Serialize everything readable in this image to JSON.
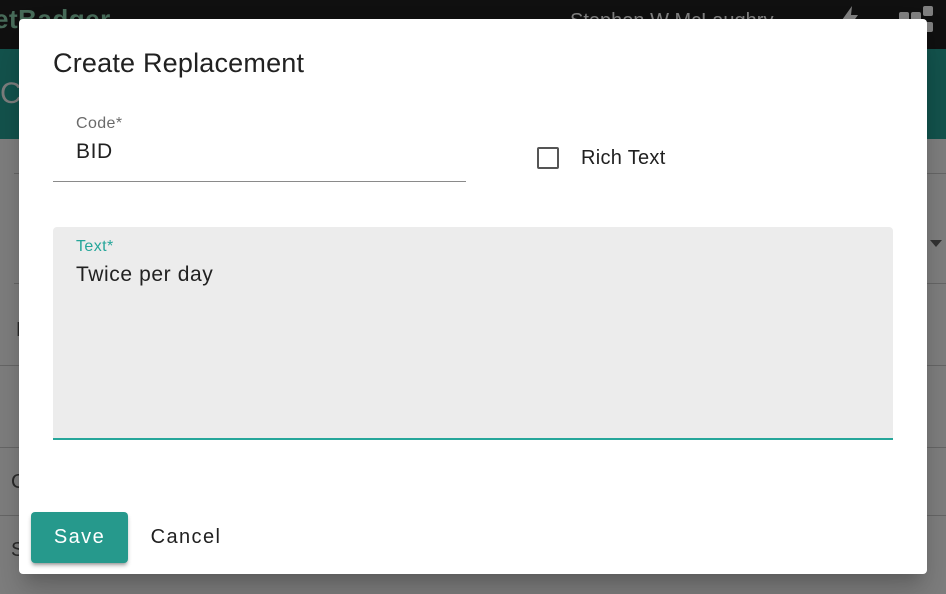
{
  "background_app": {
    "brand": "etBadger",
    "user_name": "Stephen W McLaughry",
    "green_initial": "C",
    "row_letters": [
      "E",
      "C",
      "S"
    ]
  },
  "dialog": {
    "title": "Create Replacement",
    "code": {
      "label": "Code*",
      "value": "BID"
    },
    "rich_text": {
      "label": "Rich Text",
      "checked": false
    },
    "text": {
      "label": "Text*",
      "value": "Twice per day"
    },
    "actions": {
      "save_label": "Save",
      "cancel_label": "Cancel"
    }
  },
  "colors": {
    "accent": "#26a69a",
    "save_button": "#26998c",
    "topbar": "#212121",
    "field_fill": "#ececec"
  },
  "icons": {
    "bolt": "bolt-icon",
    "apps": "apps-icon",
    "dropdown": "caret-down-icon"
  }
}
